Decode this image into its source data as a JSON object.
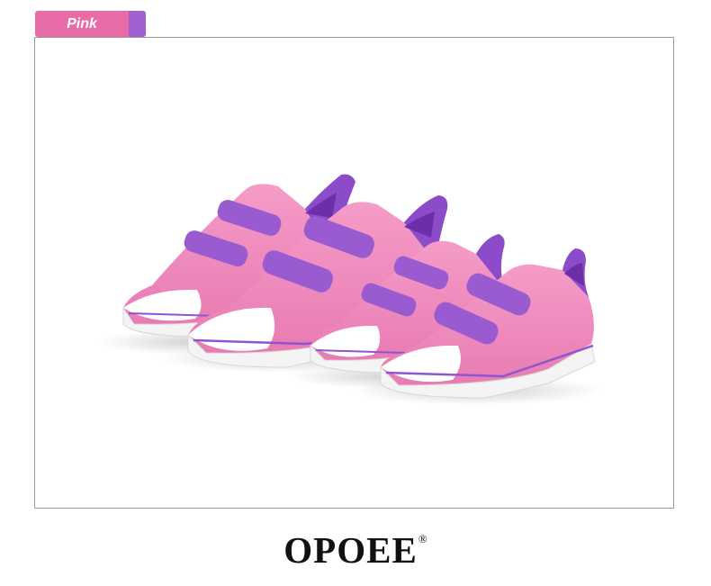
{
  "color_tag": {
    "label": "Pink",
    "tag_color": "#e86aa6",
    "swatch_color": "#a160cf"
  },
  "photo": {
    "subject": "shoes-image",
    "upper_color": "#ef8fbf",
    "strap_color": "#9a5bd0",
    "sole_color": "#ffffff"
  },
  "brand": {
    "name": "OPOEE",
    "mark": "®"
  }
}
